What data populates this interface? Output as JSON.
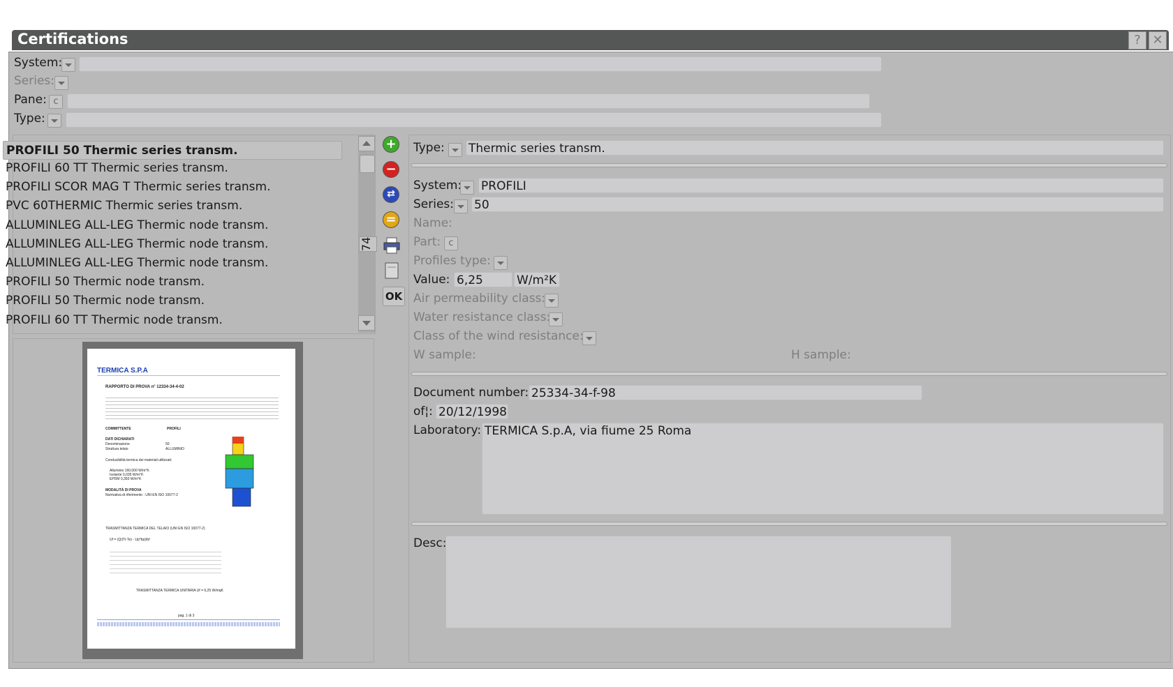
{
  "window": {
    "title": "Certifications",
    "help_label": "?",
    "close_label": "✕"
  },
  "filters": {
    "system_label": "System:",
    "series_label": "Series:",
    "pane_label": "Pane:",
    "pane_btn": "c",
    "type_label": "Type:"
  },
  "list": {
    "items": [
      "PROFILI 50 Thermic series transm.",
      "PROFILI 60 TT Thermic series transm.",
      "PROFILI SCOR MAG T Thermic series transm.",
      "PVC 60THERMIC Thermic series transm.",
      "ALLUMINLEG ALL-LEG Thermic node transm.",
      "ALLUMINLEG ALL-LEG Thermic node transm.",
      "ALLUMINLEG ALL-LEG Thermic node transm.",
      "PROFILI 50 Thermic node transm.",
      "PROFILI 50 Thermic node transm.",
      "PROFILI 60 TT Thermic node transm."
    ],
    "count": "74"
  },
  "toolbar": {
    "add_icon": "plus-circle-icon",
    "delete_icon": "minus-circle-icon",
    "swap_icon": "swap-circle-icon",
    "equal_icon": "equal-circle-icon",
    "ok_label": "OK"
  },
  "detail": {
    "type_label": "Type:",
    "type_value": "Thermic series transm.",
    "system_label": "System:",
    "system_value": "PROFILI",
    "series_label": "Series:",
    "series_value": "50",
    "name_label": "Name:",
    "part_label": "Part:",
    "part_btn": "c",
    "profiles_type_label": "Profiles type:",
    "value_label": "Value:",
    "value_value": "6,25",
    "value_unit": "W/m²K",
    "air_label": "Air permeability class:",
    "water_label": "Water resistance class:",
    "wind_label": "Class of the wind resistance:",
    "w_sample_label": "W sample:",
    "h_sample_label": "H sample:",
    "doc_number_label": "Document number:",
    "doc_number_value": "25334-34-f-98",
    "of_label": "of¦:",
    "of_value": "20/12/1998",
    "laboratory_label": "Laboratory:",
    "laboratory_value": "TERMICA S.p.A, via fiume 25 Roma",
    "desc_label": "Desc:",
    "desc_value": ""
  },
  "document": {
    "company": "TERMICA S.P.A",
    "report": "RAPPORTO DI PROVA n° 12334-34-4-02",
    "committente": "COMMITTENTE",
    "committente_value": "PROFILI",
    "dati": "DATI DICHIARATI",
    "denominazione": "Denominazione",
    "denominazione_value": "50",
    "struttura": "Struttura telaio",
    "struttura_value": "ALLUMINIO",
    "conducibilita": "Conducibilità termica dei materiali utilizzati:",
    "alluminio": "Alluminio 160,000 W/m°K",
    "isolante": "Isolante 0,035 W/m°K",
    "epdm": "EPDM 0,350 W/m°K",
    "modalita": "MODALITÀ DI PROVA",
    "normativa": "Normativa di riferimento : UNI EN ISO 10077-2",
    "trasmittanza": "TRASMITTANZA TERMICA DEL TELAIO (UNI EN ISO 10077-2)",
    "formula": "Uf = (Q/(Ti-Te) - Up*bp)/bf",
    "unitaria": "TRASMITTANZA TERMICA UNITARIA  Uf = 6,25 W/mqK",
    "page": "pag. 1 di 3"
  }
}
